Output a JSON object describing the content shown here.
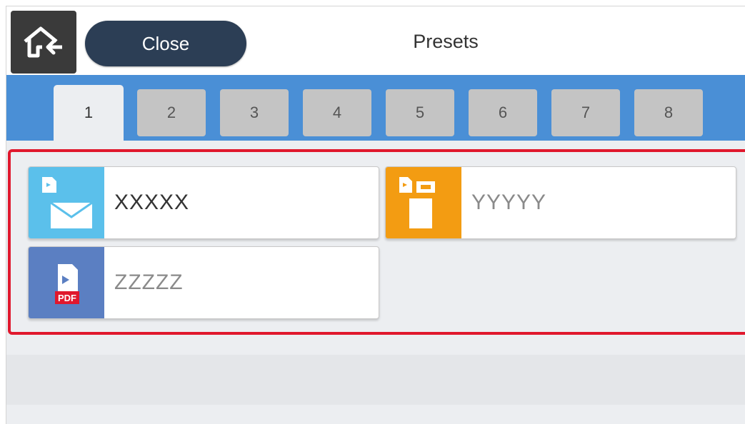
{
  "header": {
    "home_icon": "home-icon",
    "close_label": "Close",
    "title": "Presets"
  },
  "tabs": [
    {
      "label": "1",
      "active": true
    },
    {
      "label": "2",
      "active": false
    },
    {
      "label": "3",
      "active": false
    },
    {
      "label": "4",
      "active": false
    },
    {
      "label": "5",
      "active": false
    },
    {
      "label": "6",
      "active": false
    },
    {
      "label": "7",
      "active": false
    },
    {
      "label": "8",
      "active": false
    }
  ],
  "presets": [
    {
      "label": "XXXXX",
      "icon": "scan-to-email-icon",
      "icon_color": "#5bc0eb"
    },
    {
      "label": "YYYYY",
      "icon": "copy-icon",
      "icon_color": "#f39c12"
    },
    {
      "label": "ZZZZZ",
      "icon": "scan-to-pdf-icon",
      "icon_color": "#5b7fc2"
    }
  ],
  "colors": {
    "tab_bar": "#4a8fd6",
    "highlight_frame": "#e0182d",
    "close_button": "#2c3e55"
  }
}
